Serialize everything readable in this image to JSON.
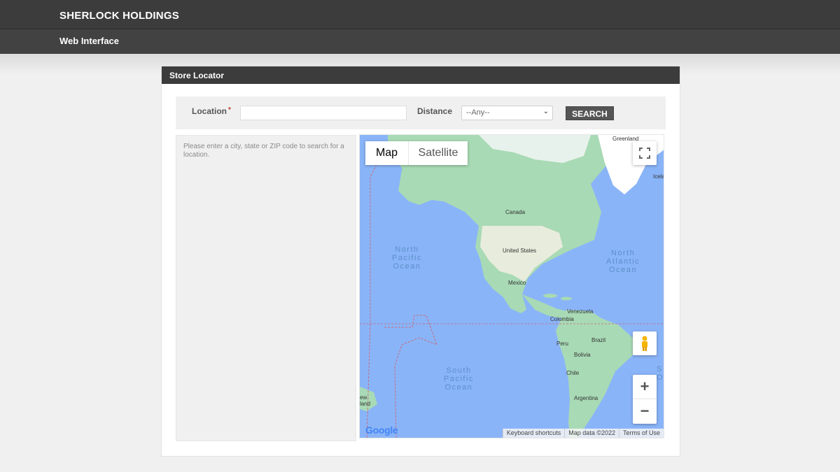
{
  "header": {
    "brand": "SHERLOCK HOLDINGS",
    "subtitle": "Web Interface"
  },
  "panel": {
    "title": "Store Locator"
  },
  "search": {
    "location_label": "Location",
    "required_mark": "*",
    "location_value": "",
    "distance_label": "Distance",
    "distance_selected": "--Any--",
    "search_button": "SEARCH"
  },
  "results": {
    "message": "Please enter a city, state or ZIP code to search for a location."
  },
  "map": {
    "type_map": "Map",
    "type_satellite": "Satellite",
    "zoom_in": "+",
    "zoom_out": "−",
    "google_logo": "Google",
    "footer": {
      "shortcuts": "Keyboard shortcuts",
      "data": "Map data ©2022",
      "terms": "Terms of Use"
    },
    "oceans": {
      "north_pacific": "North\nPacific\nOcean",
      "north_atlantic": "North\nAtlantic\nOcean",
      "south_pacific": "South\nPacific\nOcean"
    },
    "places": {
      "greenland": "Greenland",
      "iceland": "Icela",
      "canada": "Canada",
      "united_states": "United States",
      "mexico": "Mexico",
      "venezuela": "Venezuela",
      "colombia": "Colombia",
      "peru": "Peru",
      "brazil": "Brazil",
      "bolivia": "Bolivia",
      "chile": "Chile",
      "argentina": "Argentina",
      "new_zealand": "ew\nland",
      "south_edge": "S\nO"
    },
    "colors": {
      "water": "#8ab4f8",
      "land": "#a8dab5",
      "ice": "#ffffff"
    }
  }
}
